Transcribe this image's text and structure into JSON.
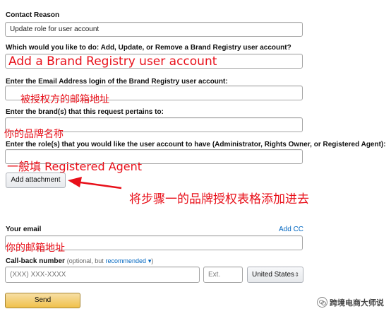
{
  "form": {
    "contact_reason_label": "Contact Reason",
    "contact_reason_value": "Update role for user account",
    "action_question": "Which would you like to do: Add, Update, or Remove a Brand Registry user account?",
    "email_question": "Enter the Email Address login of the Brand Registry user account:",
    "brand_question": "Enter the brand(s) that this request pertains to:",
    "role_question": "Enter the role(s) that you would like the user account to have (Administrator, Rights Owner, or Registered Agent):",
    "add_attachment": "Add attachment",
    "your_email_label": "Your email",
    "add_cc": "Add CC",
    "callback_label": "Call-back number",
    "callback_optional": "(optional, but",
    "callback_recommended": "recommended",
    "callback_close": ")",
    "phone_placeholder": "(XXX) XXX-XXXX",
    "ext_placeholder": "Ext.",
    "country_value": "United States",
    "send": "Send"
  },
  "annotations": {
    "action_note": "Add a Brand Registry user account",
    "email_note": "被授权方的邮箱地址",
    "brand_note": "你的品牌名称",
    "role_note": "一般填 Registered Agent",
    "attachment_note": "将步骤一的品牌授权表格添加进去",
    "your_email_note": "你的邮箱地址"
  },
  "watermark": "跨境电商大师说",
  "colors": {
    "annotation_red": "#e8101a",
    "link_blue": "#0066c0",
    "send_yellow": "#f0c14b"
  }
}
